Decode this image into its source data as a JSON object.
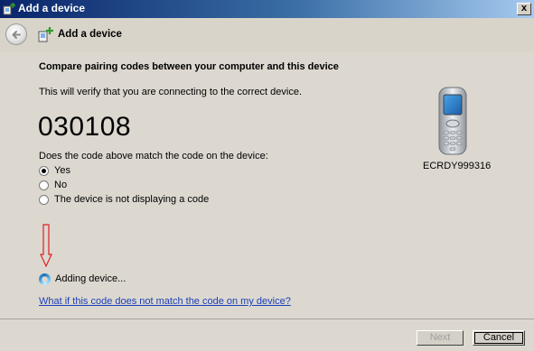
{
  "window": {
    "title": "Add a device",
    "close_label": "x"
  },
  "nav": {
    "title": "Add a device"
  },
  "main": {
    "heading": "Compare pairing codes between your computer and this device",
    "description": "This will verify that you are connecting to the correct device.",
    "code": "030108",
    "question": "Does the code above match the code on the device:",
    "options": [
      {
        "label": "Yes",
        "selected": true
      },
      {
        "label": "No",
        "selected": false
      },
      {
        "label": "The device is not displaying a code",
        "selected": false
      }
    ],
    "device_name": "ECRDY999316",
    "status_text": "Adding device...",
    "help_link": "What if this code does not match the code on my device?"
  },
  "footer": {
    "next_label": "Next",
    "cancel_label": "Cancel"
  },
  "colors": {
    "title_bar": "#0a246a",
    "panel_bg": "#dcd8d0",
    "link": "#1c3fb5",
    "annotation_arrow": "#e02020"
  }
}
